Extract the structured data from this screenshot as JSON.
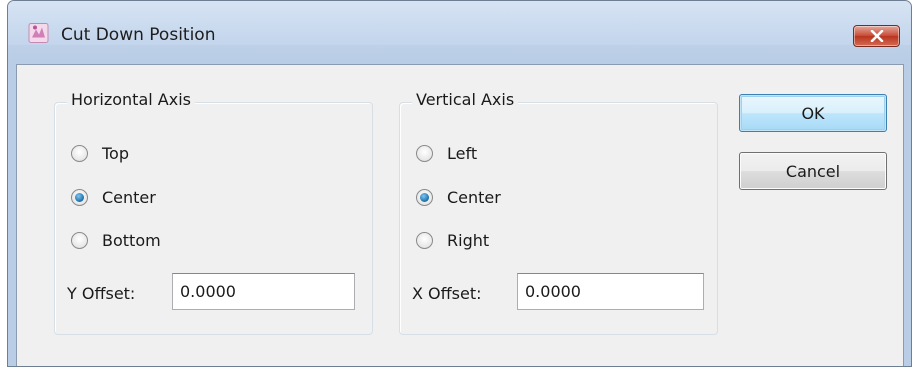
{
  "window": {
    "title": "Cut Down Position",
    "app_icon": "app-icon",
    "close_icon": "close-x-icon"
  },
  "horizontal_axis": {
    "group_label": "Horizontal Axis",
    "options": [
      {
        "label": "Top",
        "selected": false
      },
      {
        "label": "Center",
        "selected": true
      },
      {
        "label": "Bottom",
        "selected": false
      }
    ],
    "offset_label": "Y Offset:",
    "offset_value": "0.0000"
  },
  "vertical_axis": {
    "group_label": "Vertical Axis",
    "options": [
      {
        "label": "Left",
        "selected": false
      },
      {
        "label": "Center",
        "selected": true
      },
      {
        "label": "Right",
        "selected": false
      }
    ],
    "offset_label": "X Offset:",
    "offset_value": "0.0000"
  },
  "buttons": {
    "ok_label": "OK",
    "cancel_label": "Cancel"
  },
  "colors": {
    "title_bar": "#c3d5ec",
    "close_button": "#c74a35",
    "dialog_background": "#f0f0f0",
    "radio_selected": "#1a6da8"
  }
}
